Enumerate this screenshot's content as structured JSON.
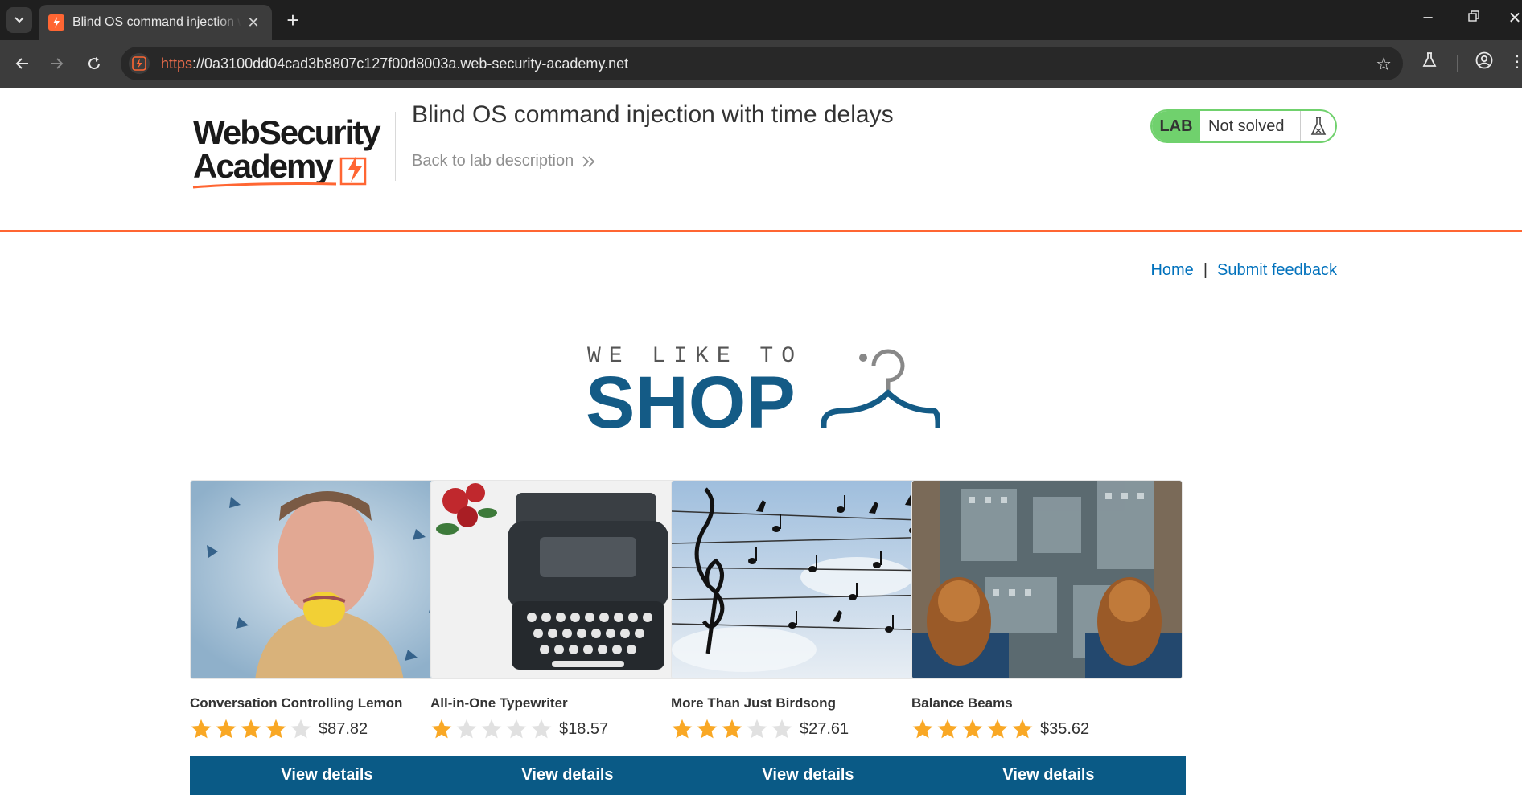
{
  "browser": {
    "tab_title": "Blind OS command injection with time delays",
    "url_scheme": "https",
    "url_rest": "://0a3100dd04cad3b8807c127f00d8003a.web-security-academy.net"
  },
  "header": {
    "logo_line1": "WebSecurity",
    "logo_line2": "Academy",
    "lab_title": "Blind OS command injection with time delays",
    "back_link": "Back to lab description",
    "lab_badge": "LAB",
    "lab_status": "Not solved"
  },
  "nav": {
    "home": "Home",
    "separator": "|",
    "feedback": "Submit feedback"
  },
  "shop_logo": {
    "tagline": "WE LIKE TO",
    "word": "SHOP"
  },
  "colors": {
    "accent_orange": "#ff6633",
    "lab_green": "#70d16d",
    "link_blue": "#0071bc",
    "shop_blue": "#145b86",
    "button_blue": "#0a5a86",
    "star_gold": "#f9a825"
  },
  "products": [
    {
      "name": "Conversation Controlling Lemon",
      "rating": 4,
      "price": "$87.82",
      "button": "View details",
      "image": "man-biting-lemon"
    },
    {
      "name": "All-in-One Typewriter",
      "rating": 1,
      "price": "$18.57",
      "button": "View details",
      "image": "typewriter-with-roses"
    },
    {
      "name": "More Than Just Birdsong",
      "rating": 3,
      "price": "$27.61",
      "button": "View details",
      "image": "birds-on-wires-music-notes"
    },
    {
      "name": "Balance Beams",
      "rating": 5,
      "price": "$35.62",
      "button": "View details",
      "image": "feet-over-city"
    }
  ]
}
